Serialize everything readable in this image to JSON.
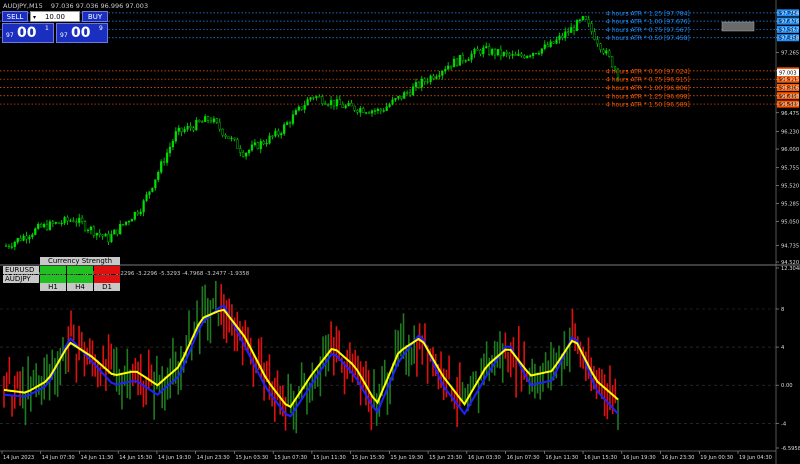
{
  "header": {
    "symbol_line": "AUDJPY,M15",
    "ohlc": "97.036 97.036 96.996 97.003"
  },
  "trade_panel": {
    "sell_label": "SELL",
    "buy_label": "BUY",
    "lot_value": "10.00",
    "sell_prefix": "97",
    "sell_big": "00",
    "sell_sup": "1",
    "buy_prefix": "97",
    "buy_big": "00",
    "buy_sup": "9"
  },
  "strength_table": {
    "title": "Currency Strength",
    "pairs": [
      "EURUSD",
      "AUDJPY"
    ],
    "timeframes": [
      "H1",
      "H4",
      "D1"
    ],
    "cells": [
      [
        "green",
        "green",
        "red"
      ],
      [
        "green",
        "green",
        "red"
      ]
    ]
  },
  "indicator": {
    "label": "vc 1(50,5mi smoothed with RWRMADS) -3.2296 -3.2296 -5.3293 -4.7968 -3.2477 -1.9358"
  },
  "colors": {
    "background": "#000000",
    "up_candle": "#00e000",
    "osc_green": "#1e7b1e",
    "osc_red": "#e01010",
    "osc_yellow": "#ffff00",
    "osc_blue": "#2020ff",
    "atr_upper": "#1e90ff",
    "atr_lower": "#ff5a00"
  },
  "atr_levels": {
    "upper": [
      {
        "label": "4 hours ATR * 1.25 [97.784]",
        "price": 97.784
      },
      {
        "label": "4 hours ATR * 1.00 [97.676]",
        "price": 97.676
      },
      {
        "label": "4 hours ATR * 0.75 [97.567]",
        "price": 97.567
      },
      {
        "label": "4 hours ATR * 0.50 [97.458]",
        "price": 97.458
      }
    ],
    "lower": [
      {
        "label": "4 hours ATR * 0.50 [97.024]",
        "price": 97.024
      },
      {
        "label": "4 hours ATR * 0.75 [96.915]",
        "price": 96.915
      },
      {
        "label": "4 hours ATR * 1.00 [96.806]",
        "price": 96.806
      },
      {
        "label": "4 hours ATR * 1.25 [96.698]",
        "price": 96.698
      },
      {
        "label": "4 hours ATR * 1.50 [96.589]",
        "price": 96.589
      }
    ]
  },
  "chart_data": [
    {
      "type": "candlestick",
      "title": "AUDJPY,M15",
      "price_scale": [
        "97.784",
        "97.676",
        "97.567",
        "97.458",
        "97.265",
        "97.024",
        "96.915",
        "96.806",
        "96.698",
        "96.589",
        "96.475",
        "96.230",
        "96.000",
        "95.755",
        "95.520",
        "95.285",
        "95.050",
        "94.735",
        "94.520"
      ],
      "ylim": [
        94.52,
        97.9
      ],
      "current_price_label": "97.003",
      "price_path": [
        {
          "x": "14 Jun 2023",
          "close": 94.73
        },
        {
          "x": "14 Jun 11:30",
          "close": 94.97
        },
        {
          "x": "14 Jun 15:30",
          "close": 95.08
        },
        {
          "x": "14 Jun 19:30",
          "close": 94.82
        },
        {
          "x": "14 Jun 23:30",
          "close": 95.25
        },
        {
          "x": "15 Jun 03:30",
          "close": 96.2
        },
        {
          "x": "15 Jun 07:30",
          "close": 96.4
        },
        {
          "x": "15 Jun 11:30",
          "close": 95.95
        },
        {
          "x": "15 Jun 15:30",
          "close": 96.2
        },
        {
          "x": "15 Jun 19:30",
          "close": 96.7
        },
        {
          "x": "15 Jun 23:30",
          "close": 96.55
        },
        {
          "x": "16 Jun 03:30",
          "close": 96.5
        },
        {
          "x": "16 Jun 07:30",
          "close": 96.8
        },
        {
          "x": "16 Jun 11:30",
          "close": 97.1
        },
        {
          "x": "16 Jun 15:30",
          "close": 97.3
        },
        {
          "x": "16 Jun 19:30",
          "close": 97.2
        },
        {
          "x": "16 Jun 23:30",
          "close": 97.35
        },
        {
          "x": "19 Jun 00:30",
          "close": 97.7
        },
        {
          "x": "19 Jun 04:30",
          "close": 97.0
        }
      ]
    },
    {
      "type": "line",
      "title": "vc 1(50,5mi smoothed with RWRMADS)",
      "y_scale": [
        "12.3048",
        "8",
        "4",
        "0.00",
        "-4",
        "-6.5958"
      ],
      "ylim": [
        -6.5958,
        12.3048
      ],
      "x_labels": [
        "14 Jun 2023",
        "14 Jun 07:30",
        "14 Jun 11:30",
        "14 Jun 15:30",
        "14 Jun 19:30",
        "14 Jun 23:30",
        "15 Jun 03:30",
        "15 Jun 07:30",
        "15 Jun 11:30",
        "15 Jun 15:30",
        "15 Jun 19:30",
        "15 Jun 23:30",
        "16 Jun 03:30",
        "16 Jun 07:30",
        "16 Jun 11:30",
        "16 Jun 15:30",
        "16 Jun 19:30",
        "16 Jun 23:30",
        "19 Jun 00:30",
        "19 Jun 04:30"
      ],
      "series": [
        {
          "name": "signal",
          "color": "yellow",
          "values": [
            -0.5,
            -0.8,
            0.5,
            4.5,
            3.0,
            1.0,
            1.5,
            0.0,
            2.0,
            7.0,
            8.0,
            5.0,
            0.5,
            -2.5,
            1.0,
            4.0,
            2.0,
            -2.0,
            3.5,
            5.0,
            1.0,
            -2.0,
            2.0,
            4.0,
            1.0,
            1.5,
            5.0,
            0.5,
            -1.5
          ]
        },
        {
          "name": "smoothed",
          "color": "blue",
          "values": [
            -1.0,
            -1.2,
            0.0,
            5.0,
            2.5,
            0.0,
            0.5,
            -1.0,
            1.0,
            6.5,
            8.5,
            4.0,
            -0.5,
            -3.5,
            0.0,
            3.5,
            1.0,
            -3.0,
            2.5,
            5.5,
            0.0,
            -3.0,
            1.0,
            4.5,
            0.0,
            0.5,
            5.5,
            -0.5,
            -3.0
          ]
        }
      ]
    }
  ]
}
